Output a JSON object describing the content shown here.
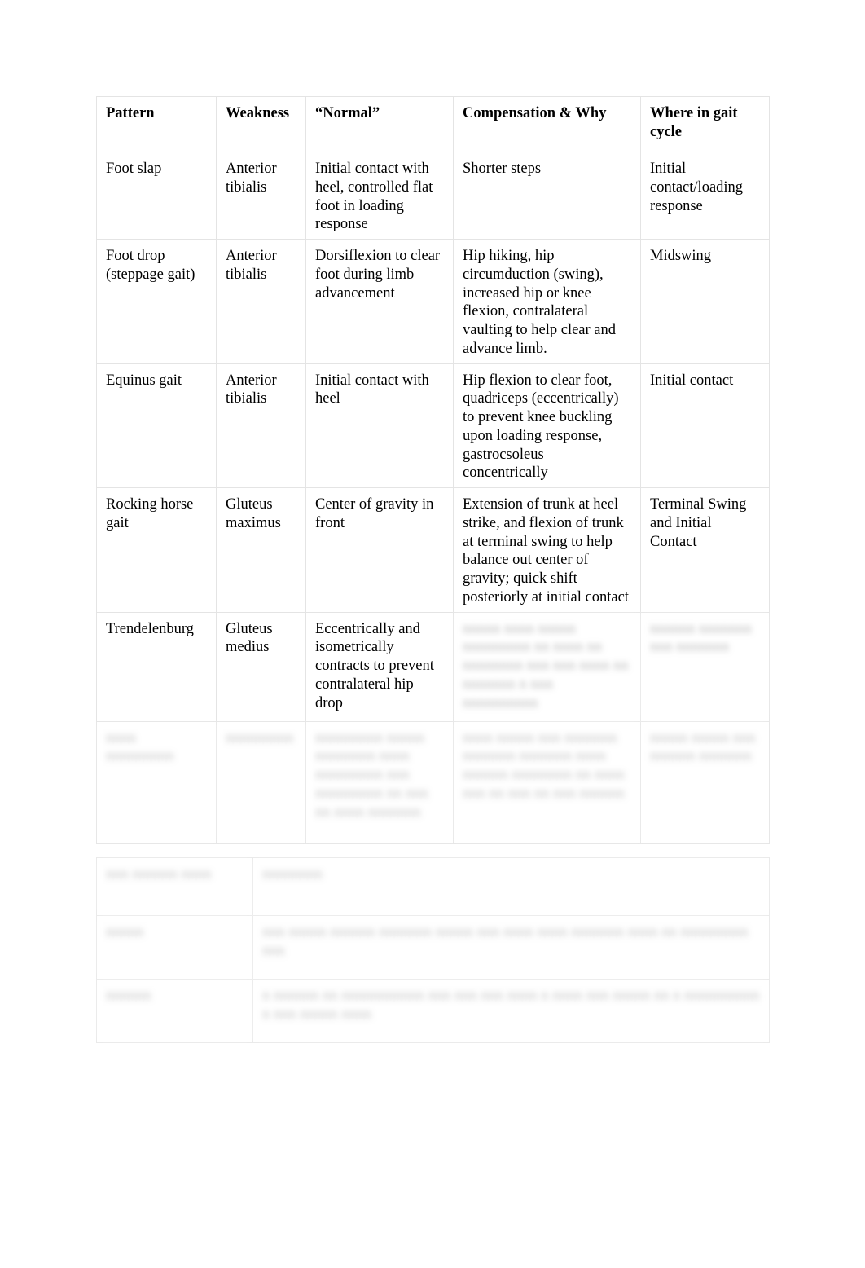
{
  "document": {
    "background_color": "#ffffff",
    "text_color": "#000000",
    "border_color": "#e4e4e4"
  },
  "main_table": {
    "name": "gait-deviation-patterns-table",
    "headers": [
      "Pattern",
      "Weakness",
      "“Normal”",
      "Compensation & Why",
      "Where in gait cycle"
    ],
    "rows": [
      {
        "legible": true,
        "pattern": "Foot slap",
        "weakness": "Anterior tibialis",
        "normal": "Initial contact with heel, controlled flat foot in loading response",
        "compensation": "Shorter steps",
        "where": "Initial contact/loading response"
      },
      {
        "legible": true,
        "pattern": "Foot drop (steppage gait)",
        "weakness": "Anterior tibialis",
        "normal": "Dorsiflexion to clear foot during limb advancement",
        "compensation": "Hip hiking, hip circumduction (swing), increased hip or knee flexion, contralateral vaulting to help clear and advance limb.",
        "where": "Midswing"
      },
      {
        "legible": true,
        "pattern": "Equinus gait",
        "weakness": "Anterior tibialis",
        "normal": "Initial contact with heel",
        "compensation": "Hip flexion to clear foot, quadriceps (eccentrically) to prevent knee buckling upon loading response, gastrocsoleus concentrically",
        "where": "Initial contact"
      },
      {
        "legible": true,
        "pattern": "Rocking horse gait",
        "weakness": "Gluteus maximus",
        "normal": "Center of gravity in front",
        "compensation": "Extension of trunk at heel strike, and flexion of trunk at terminal swing to help balance out center of gravity; quick shift posteriorly at initial contact",
        "where": "Terminal Swing and Initial Contact"
      },
      {
        "legible": "partial",
        "pattern": "Trendelenburg",
        "weakness": "Gluteus medius",
        "normal": "Eccentrically and isometrically contracts to prevent contralateral hip drop",
        "compensation": "nnnnn nnnn nnnnn nnnnnnnnn nn nnnn nn nnnnnnnn nnn nnn nnnn nn nnnnnnn n nnn nnnnnnnnnn",
        "where": "nnnnnn nnnnnnn nnn nnnnnnn"
      },
      {
        "legible": false,
        "pattern": "nnnn nnnnnnnnn",
        "weakness": "nnnnnnnnn",
        "normal": "nnnnnnnnn nnnnn nnnnnnnn nnnn nnnnnnnnn nnn nnnnnnnnn nn nnn nn nnnn nnnnnnn",
        "compensation": "nnnn nnnnn nnn nnnnnnn nnnnnnn nnnnnnn nnnn nnnnnn nnnnnnnn nn nnnn nnn nn nnn nn nnn nnnnnn",
        "where": "nnnnn nnnnn nnn nnnnnn nnnnnnn"
      }
    ]
  },
  "sub_table": {
    "name": "secondary-reference-table",
    "headers": [
      "nnn nnnnnn nnnn",
      "nnnnnnnn"
    ],
    "rows": [
      {
        "legible": false,
        "label": "nnnnn",
        "description": "nnn nnnnn nnnnnn nnnnnnn nnnnn nnn nnnn nnnn nnnnnnn nnnn nn nnnnnnnnn nnn"
      },
      {
        "legible": false,
        "label": "nnnnnn",
        "description": "n nnnnnn nn nnnnnnnnnnn nnn nnn nnn nnnn n nnnn nnn nnnnn nn n nnnnnnnnnn n nnn nnnnn nnnn"
      }
    ]
  }
}
